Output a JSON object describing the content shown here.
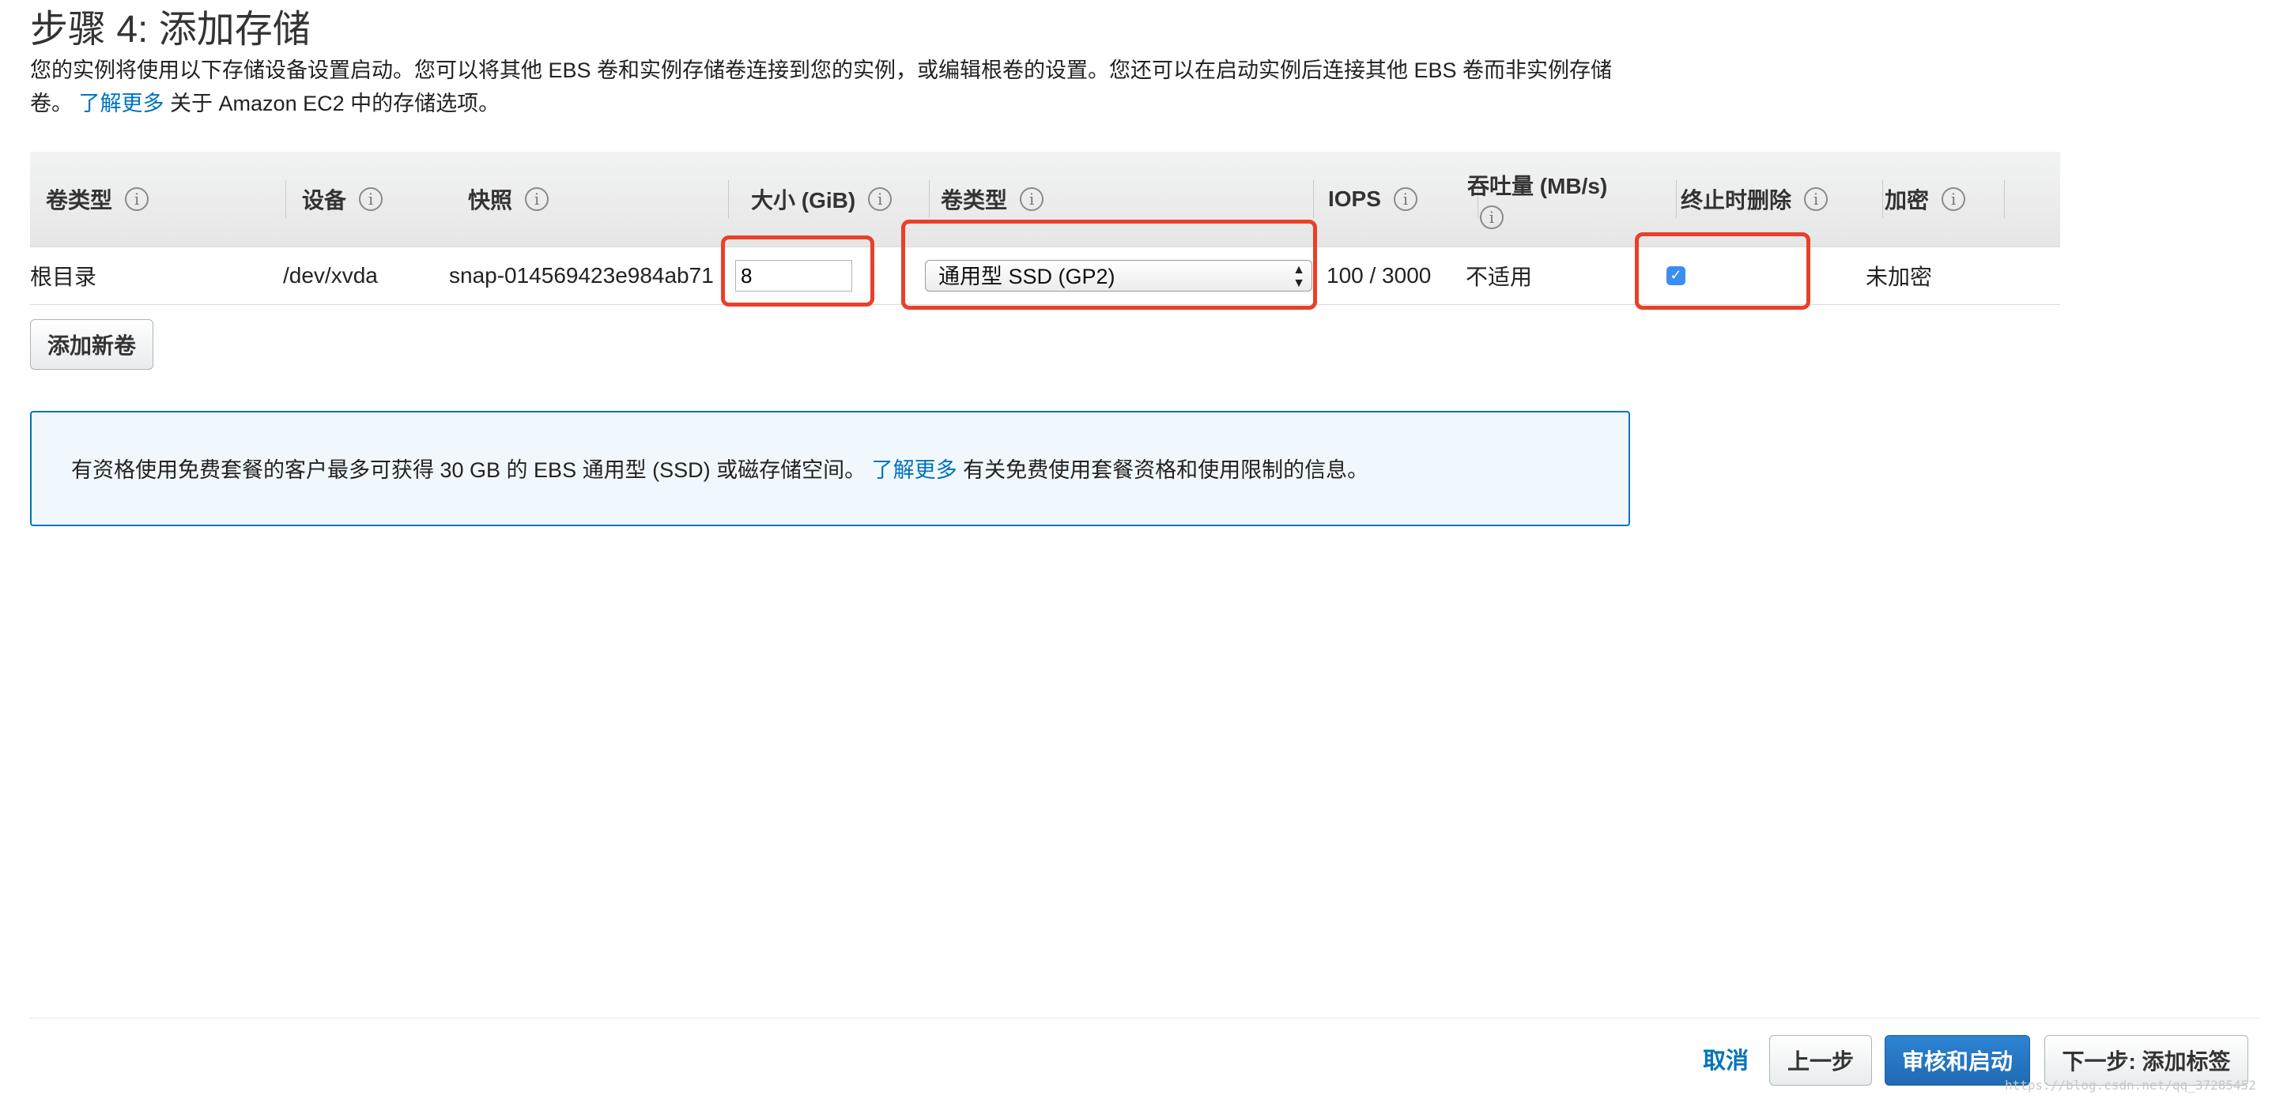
{
  "page": {
    "title": "步骤 4: 添加存储",
    "description_part1": "您的实例将使用以下存储设备设置启动。您可以将其他 EBS 卷和实例存储卷连接到您的实例，或编辑根卷的设置。您还可以在启动实例后连接其他 EBS 卷而非实例存储卷。",
    "learn_more": "了解更多",
    "description_part2": " 关于 Amazon EC2 中的存储选项。"
  },
  "table": {
    "headers": {
      "volume_type": "卷类型",
      "device": "设备",
      "snapshot": "快照",
      "size": "大小 (GiB)",
      "ebs_type": "卷类型",
      "iops": "IOPS",
      "throughput": "吞吐量 (MB/s)",
      "delete_on_termination": "终止时删除",
      "encryption": "加密"
    },
    "row": {
      "volume_type": "根目录",
      "device": "/dev/xvda",
      "snapshot": "snap-014569423e984ab71",
      "size": "8",
      "ebs_type": "通用型 SSD (GP2)",
      "iops": "100 / 3000",
      "throughput": "不适用",
      "delete_on_termination": true,
      "encryption": "未加密"
    }
  },
  "buttons": {
    "add_volume": "添加新卷",
    "cancel": "取消",
    "previous": "上一步",
    "review_launch": "审核和启动",
    "next": "下一步: 添加标签"
  },
  "notice": {
    "text1": "有资格使用免费套餐的客户最多可获得 30 GB 的 EBS 通用型 (SSD) 或磁存储空间。",
    "learn_more": "了解更多",
    "text2": " 有关免费使用套餐资格和使用限制的信息。"
  },
  "icons": {
    "info": "info-icon",
    "checkbox": "checkmark-icon",
    "select_arrows": "updown-arrows-icon"
  },
  "colors": {
    "link": "#0073bb",
    "highlight": "#e8402a",
    "primary_button": "#1f6ab3",
    "notice_border": "#0073bb",
    "notice_bg": "#f1f8fd"
  },
  "watermark": "https://blog.csdn.net/qq_37285452"
}
